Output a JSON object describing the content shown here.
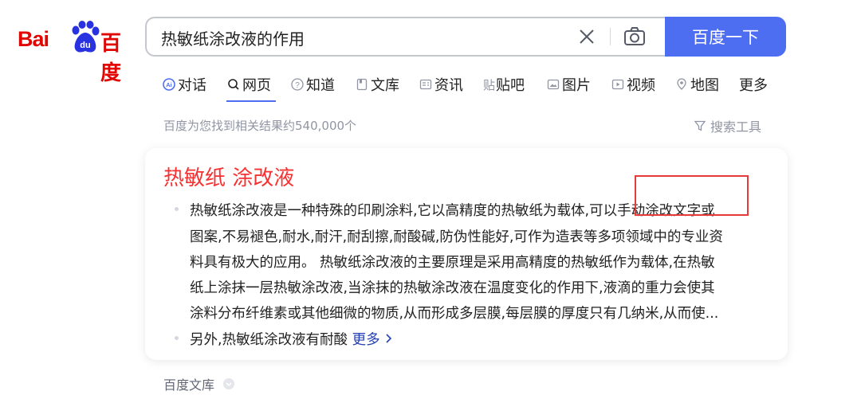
{
  "logo": {
    "left": "Bai",
    "mid": "du",
    "right": "百度"
  },
  "search": {
    "query": "热敏纸涂改液的作用",
    "button": "百度一下"
  },
  "tabs": [
    "对话",
    "网页",
    "知道",
    "文库",
    "资讯",
    "贴吧",
    "图片",
    "视频",
    "地图",
    "更多"
  ],
  "tabs_active": "网页",
  "result_count": "百度为您找到相关结果约540,000个",
  "search_tools": "搜索工具",
  "result": {
    "title": "热敏纸 涂改液",
    "lines": [
      "热敏纸涂改液是一种特殊的印刷涂料,它以高精度的热敏纸为载体,可以手动涂改文字或",
      "图案,不易褪色,耐水,耐汗,耐刮擦,耐酸碱,防伪性能好,可作为造表等多项领域中的专业资",
      "料具有极大的应用。 热敏纸涂改液的主要原理是采用高精度的热敏纸作为载体,在热敏",
      "纸上涂抹一层热敏涂改液,当涂抹的热敏涂改液在温度变化的作用下,液滴的重力会使其",
      "涂料分布纤维素或其他细微的物质,从而形成多层膜,每层膜的厚度只有几纳米,从而使..."
    ],
    "second_bullet": "另外,热敏纸涂改液有耐酸",
    "more": "更多",
    "source": "百度文库"
  },
  "colors": {
    "accent": "#4e6ef2",
    "title_red": "#f73131",
    "logo_red": "#e10601",
    "link": "#2440b3"
  }
}
